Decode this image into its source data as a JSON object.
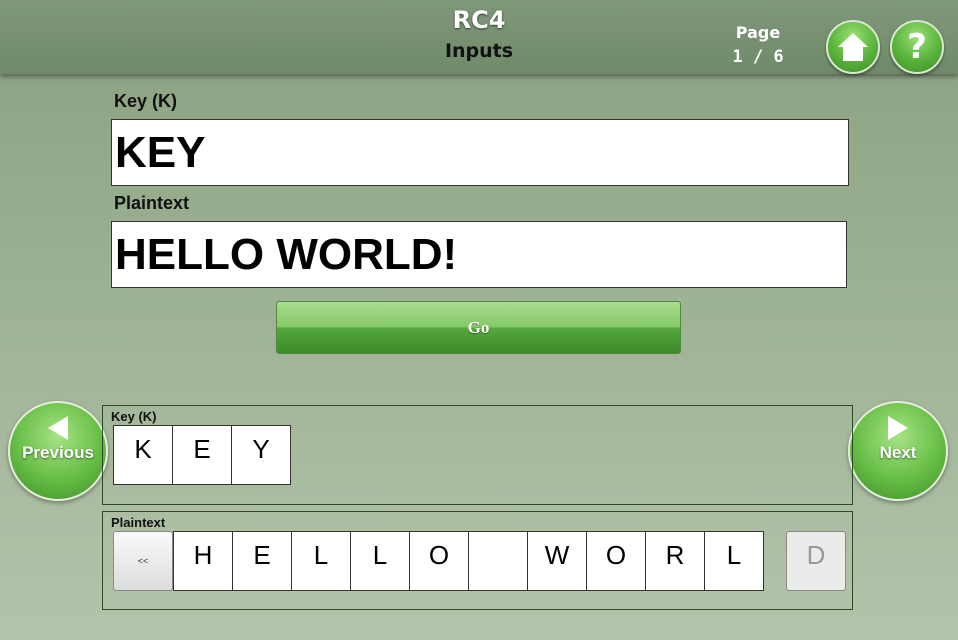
{
  "header": {
    "title": "RC4",
    "subtitle": "Inputs",
    "page_label": "Page",
    "page_number": "1  /  6",
    "home_icon": "home-icon",
    "help_icon": "help-icon"
  },
  "form": {
    "key_label": "Key (K)",
    "key_value": "KEY",
    "plaintext_label": "Plaintext",
    "plaintext_value": "HELLO WORLD!",
    "go_label": "Go"
  },
  "nav": {
    "previous_label": "Previous",
    "next_label": "Next"
  },
  "key_panel": {
    "title": "Key (K)",
    "cells": [
      "K",
      "E",
      "Y"
    ]
  },
  "plaintext_panel": {
    "title": "Plaintext",
    "scroll_left_label": "<<",
    "cells": [
      "H",
      "E",
      "L",
      "L",
      "O",
      " ",
      "W",
      "O",
      "R",
      "L"
    ],
    "partial_cell": "D"
  },
  "colors": {
    "accent_green": "#58b23b",
    "header_bg": "#6f8a69",
    "background": "#9db193"
  }
}
